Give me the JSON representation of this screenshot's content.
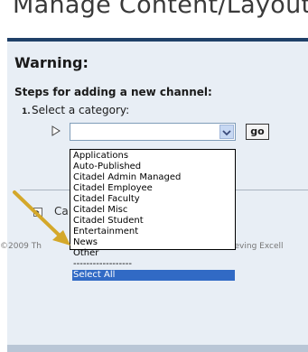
{
  "header": {
    "title": "Manage Content/Layout"
  },
  "warning": {
    "text": "Warning:"
  },
  "steps": {
    "heading": "Steps for adding a new channel:",
    "step1_number": "1.",
    "step1_label": "Select a category:"
  },
  "category_select": {
    "value": "",
    "go_label": "go",
    "options": [
      "Applications",
      "Auto-Published",
      "Citadel Admin Managed",
      "Citadel Employee",
      "Citadel Faculty",
      "Citadel Misc",
      "Citadel Student",
      "Entertainment",
      "News",
      "Other",
      "------------------",
      "Select All"
    ],
    "highlighted_option": "Select All"
  },
  "collapsed_section": {
    "label_partial": "Ca"
  },
  "footer": {
    "left_partial": "©2009 Th",
    "right_partial": "ieving Excell"
  },
  "colors": {
    "header_rule": "#1f4068",
    "panel_background": "#e8eef5",
    "selection_highlight": "#316ac5",
    "annotation_arrow": "#d4a82a"
  },
  "icons": {
    "step_pointer": "play-outline-icon",
    "dropdown_arrow": "chevron-down-icon",
    "expand": "expand-icon",
    "annotation": "arrow-icon"
  }
}
